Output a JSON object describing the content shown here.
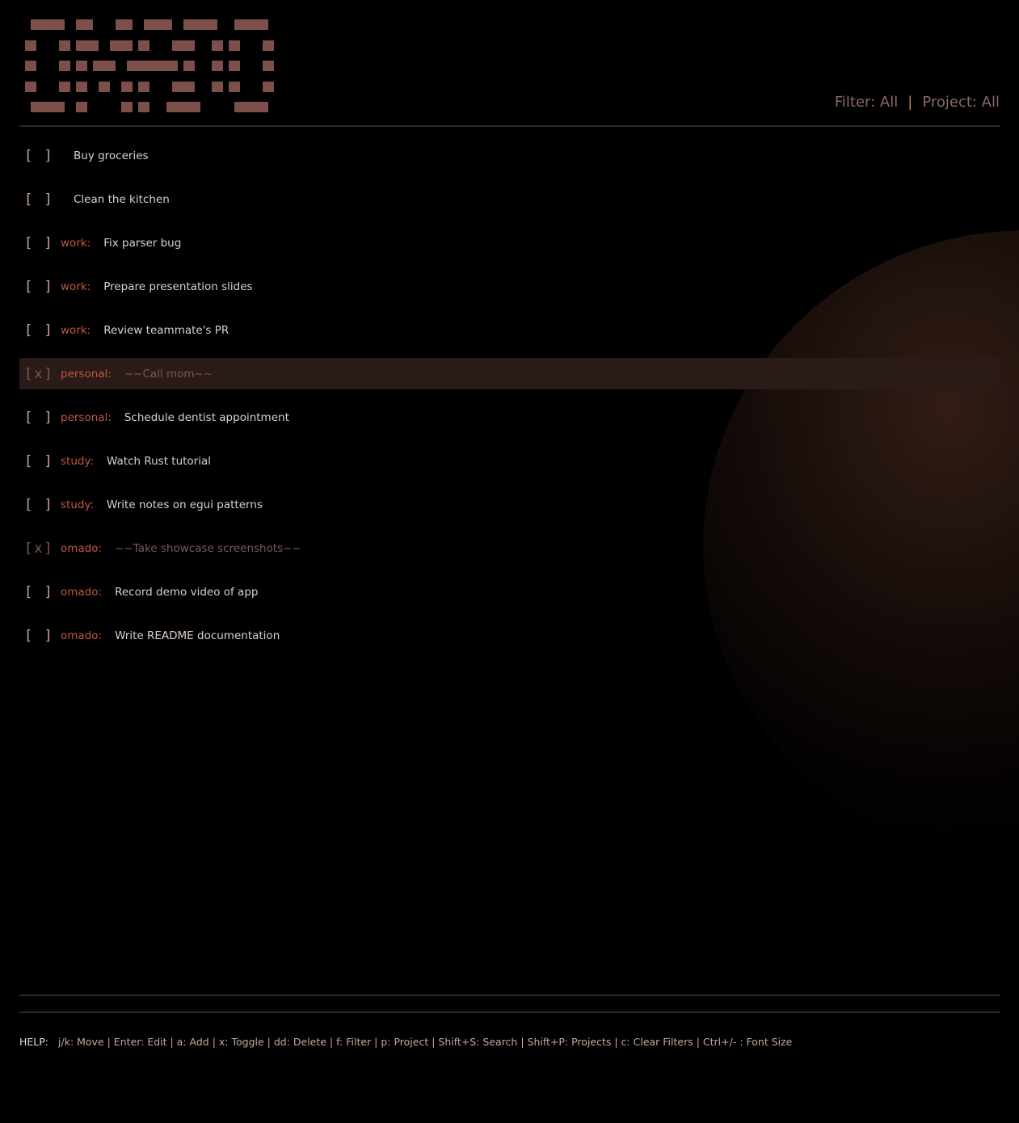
{
  "app": {
    "logo_text": "OMADO"
  },
  "header": {
    "filter_label": "Filter: All",
    "separator": "|",
    "project_label": "Project: All"
  },
  "tasks": [
    {
      "checkbox": "[ ]",
      "project": "",
      "title": "Buy groceries",
      "done": false
    },
    {
      "checkbox": "[ ]",
      "project": "",
      "title": "Clean the kitchen",
      "done": false
    },
    {
      "checkbox": "[ ]",
      "project": "work:",
      "title": "Fix parser bug",
      "done": false
    },
    {
      "checkbox": "[ ]",
      "project": "work:",
      "title": "Prepare presentation slides",
      "done": false
    },
    {
      "checkbox": "[ ]",
      "project": "work:",
      "title": "Review teammate's PR",
      "done": false
    },
    {
      "checkbox": "[x]",
      "project": "personal:",
      "title": "~~Call mom~~",
      "done": true,
      "selected": true
    },
    {
      "checkbox": "[ ]",
      "project": "personal:",
      "title": "Schedule dentist appointment",
      "done": false
    },
    {
      "checkbox": "[ ]",
      "project": "study:",
      "title": "Watch Rust tutorial",
      "done": false
    },
    {
      "checkbox": "[ ]",
      "project": "study:",
      "title": "Write notes on egui patterns",
      "done": false
    },
    {
      "checkbox": "[x]",
      "project": "omado:",
      "title": "~~Take showcase screenshots~~",
      "done": true
    },
    {
      "checkbox": "[ ]",
      "project": "omado:",
      "title": "Record demo video of app",
      "done": false
    },
    {
      "checkbox": "[ ]",
      "project": "omado:",
      "title": "Write README documentation",
      "done": false
    }
  ],
  "footer": {
    "help_label": "HELP:",
    "help_text": "j/k: Move | Enter: Edit | a: Add | x: Toggle | dd: Delete | f: Filter | p: Project | Shift+S: Search | Shift+P: Projects | c: Clear Filters | Ctrl+/- : Font Size"
  },
  "colors": {
    "background": "#000000",
    "project_tag": "#c0573f",
    "task_text": "#ddd0c8",
    "done_text": "#7a5a55",
    "logo": "#7c4f4a",
    "selected_row": "#2a1a18"
  }
}
